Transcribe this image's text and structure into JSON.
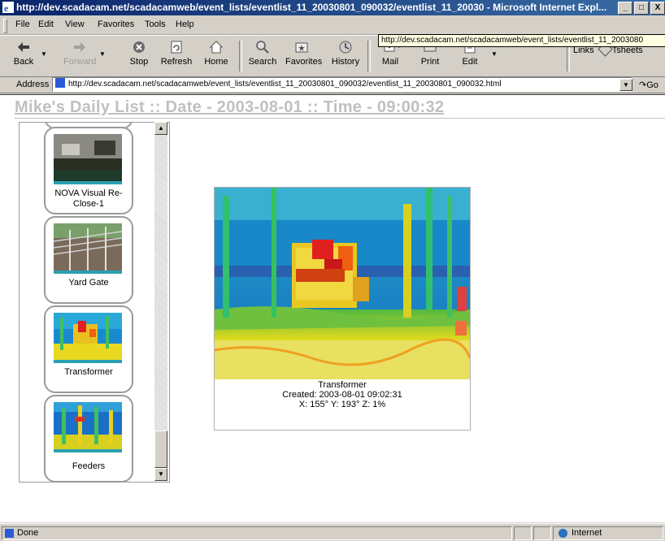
{
  "window": {
    "title": "http://dev.scadacam.net/scadacamweb/event_lists/eventlist_11_20030801_090032/eventlist_11_20030 - Microsoft Internet Expl...",
    "controls": [
      "_",
      "□",
      "X"
    ]
  },
  "menu": {
    "items": [
      "File",
      "Edit",
      "View",
      "Favorites",
      "Tools",
      "Help"
    ]
  },
  "tooltip": "http://dev.scadacam.net/scadacamweb/event_lists/eventlist_11_2003080",
  "toolbar": {
    "back": "Back",
    "forward": "Forward",
    "stop": "Stop",
    "refresh": "Refresh",
    "home": "Home",
    "search": "Search",
    "favorites": "Favorites",
    "history": "History",
    "mail": "Mail",
    "print": "Print",
    "edit": "Edit",
    "links": "Links",
    "tsheets": "Tsheets"
  },
  "address": {
    "label": "Address",
    "url": "http://dev.scadacam.net/scadacamweb/event_lists/eventlist_11_20030801_090032/eventlist_11_20030801_090032.html",
    "go": "Go"
  },
  "page": {
    "heading": "Mike's Daily List :: Date - 2003-08-01 :: Time - 09:00:32",
    "thumbnails": [
      {
        "label": "NOVA Visual Re-Close-1",
        "icon": "visual-camera-thumbnail"
      },
      {
        "label": "Yard Gate",
        "icon": "yard-gate-thumbnail"
      },
      {
        "label": "Transformer",
        "icon": "thermal-transformer-thumbnail"
      },
      {
        "label": "Feeders",
        "icon": "thermal-feeders-thumbnail"
      }
    ],
    "main_image": {
      "name": "Transformer",
      "created": "Created: 2003-08-01 09:02:31",
      "coords": "X: 155° Y: 193° Z: 1%"
    }
  },
  "status": {
    "text": "Done",
    "zone": "Internet"
  },
  "colors": {
    "titlebar_start": "#0a246a",
    "titlebar_end": "#3a6ea5",
    "chrome": "#d4d0c8",
    "heading": "#c0c0c0"
  }
}
